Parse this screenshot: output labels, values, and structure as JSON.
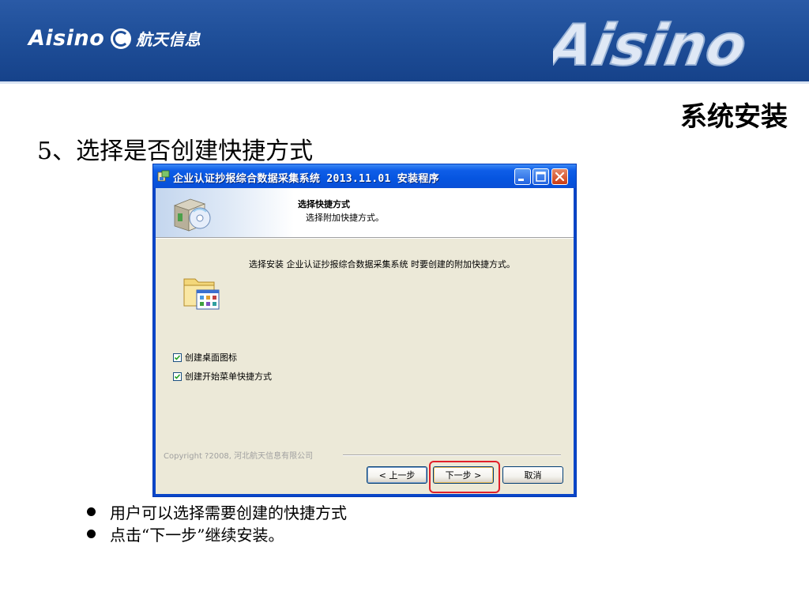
{
  "banner": {
    "brand_latin": "Aisino",
    "brand_cn": "航天信息",
    "brand_large": "Aisino"
  },
  "slide": {
    "section_title": "系统安装",
    "step_title": "5、选择是否创建快捷方式",
    "bullets": [
      "用户可以选择需要创建的快捷方式",
      "点击“下一步”继续安装。"
    ]
  },
  "installer": {
    "window_title": "企业认证抄报综合数据采集系统 2013.11.01 安装程序",
    "header_title": "选择快捷方式",
    "header_subtitle": "选择附加快捷方式。",
    "description": "选择安装 企业认证抄报综合数据采集系统 时要创建的附加快捷方式。",
    "options": [
      {
        "label": "创建桌面图标",
        "checked": true
      },
      {
        "label": "创建开始菜单快捷方式",
        "checked": true
      }
    ],
    "copyright": "Copyright ?2008, 河北航天信息有限公司",
    "buttons": {
      "back": "< 上一步",
      "next": "下一步 >",
      "cancel": "取消"
    }
  },
  "colors": {
    "banner": "#1f4f99",
    "xp_titlebar": "#0655e0",
    "dialog_face": "#ece9d8",
    "highlight": "#e0202a"
  }
}
